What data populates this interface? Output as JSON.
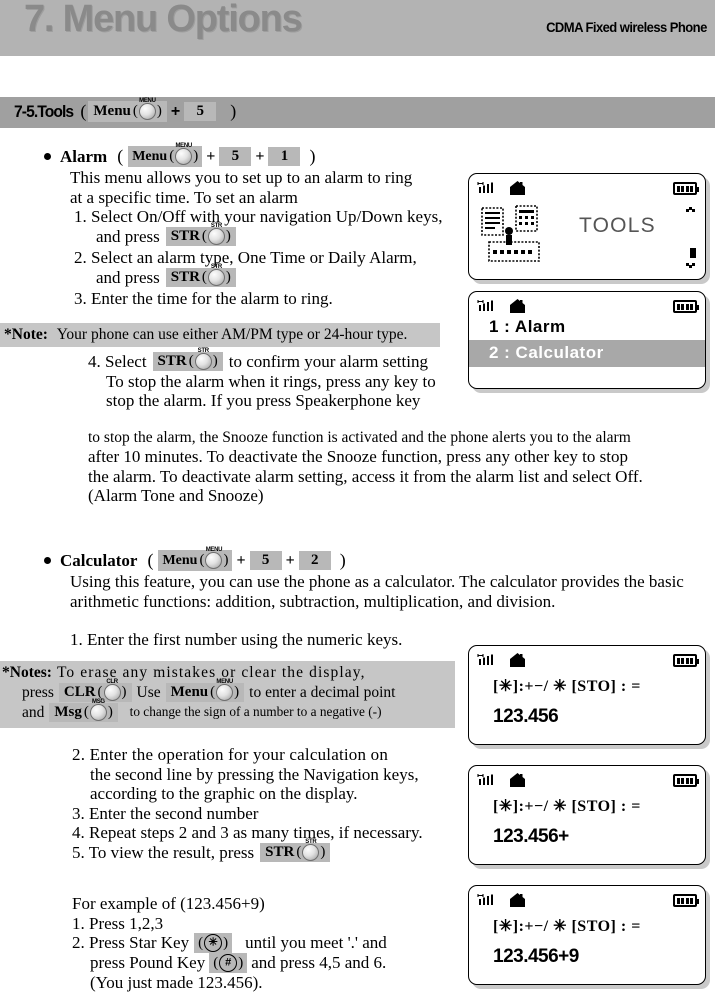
{
  "banner": {
    "title": "7. Menu Options",
    "subtitle": "CDMA Fixed wireless Phone"
  },
  "section": {
    "title": "7-5.Tools",
    "open_paren": "(",
    "menu_chip": {
      "label": "Menu",
      "key": "MENU"
    },
    "plus1": "+",
    "num1": "5",
    "close_paren": ")"
  },
  "alarm": {
    "heading": "Alarm",
    "open_paren": "(",
    "menu_chip": {
      "label": "Menu",
      "key": "MENU"
    },
    "plus1": "+",
    "num1": "5",
    "plus2": "+",
    "num2": "1",
    "close_paren": ")",
    "intro_line1": "This menu allows you to set up to an alarm to ring",
    "intro_line2": "at a specific time. To set an alarm",
    "step1_a": "1. Select On/Off with your navigation Up/Down keys,",
    "step1_b": "and press",
    "step1_chip": {
      "label": "STR",
      "key": "STR"
    },
    "step2_a": "2. Select an alarm type, One Time or Daily Alarm,",
    "step2_b": "and press",
    "step2_chip": {
      "label": "STR",
      "key": "STR"
    },
    "step3": "3. Enter the time for the alarm to ring.",
    "note_label": "*Note:",
    "note_text": "Your phone can use either AM/PM type or 24-hour type.",
    "step4_a": "4. Select",
    "step4_chip": {
      "label": "STR",
      "key": "STR"
    },
    "step4_b": "to confirm your alarm setting",
    "step4_line2": "To stop the alarm when it rings, press any key to",
    "step4_line3": "stop the alarm. If you press Speakerphone key",
    "wide_line1": "to stop the alarm, the Snooze function is activated and the phone alerts you to the alarm",
    "wide_line2": "after 10 minutes. To deactivate the Snooze function, press any other key to stop",
    "wide_line3": "the alarm. To deactivate alarm setting, access it from the alarm list and select Off.",
    "wide_line4": "(Alarm Tone and Snooze)"
  },
  "calculator": {
    "heading": "Calculator",
    "open_paren": "(",
    "menu_chip": {
      "label": "Menu",
      "key": "MENU"
    },
    "plus1": "+",
    "num1": "5",
    "plus2": "+",
    "num2": "2",
    "close_paren": ")",
    "intro_line1": "Using this feature, you can use the phone as a calculator. The calculator provides the basic",
    "intro_line2": "arithmetic functions: addition, subtraction, multiplication, and division.",
    "step1": "1. Enter the first number using the numeric keys.",
    "notes_label": "*Notes:",
    "notes_line1": "To erase any mistakes or clear the display,",
    "notes_line2_a": "press",
    "notes_clr_chip": {
      "label": "CLR",
      "key": "CLR"
    },
    "notes_line2_b": "Use",
    "notes_menu_chip": {
      "label": "Menu",
      "key": "MENU"
    },
    "notes_line2_c": "to enter a decimal point",
    "notes_line3_a": "and",
    "notes_msg_chip": {
      "label": "Msg",
      "key": "MSG"
    },
    "notes_line3_b": "to change the sign of a number to a negative (-)",
    "step2_a": "2. Enter the operation for your calculation on",
    "step2_b": "the second line by pressing the Navigation keys,",
    "step2_c": "according to the graphic on the display.",
    "step3": "3. Enter the second number",
    "step4": "4. Repeat steps 2 and 3 as many times, if necessary.",
    "step5_a": "5. To view the result, press",
    "step5_chip": {
      "label": "STR",
      "key": "STR"
    },
    "example_title": "For example of (123.456+9)",
    "ex1": "1. Press 1,2,3",
    "ex2_a": "2. Press Star Key",
    "ex2_star_chip": "✳",
    "ex2_b": "until you meet '.' and",
    "ex2_c": "press Pound Key",
    "ex2_pound_chip": "#",
    "ex2_d": "and press 4,5 and 6.",
    "ex2_e": "(You just made 123.456)."
  },
  "screens": {
    "tools": {
      "title": "TOOLS",
      "battery_bars": 4
    },
    "menu_list": {
      "item1": "1 : Alarm",
      "item2": "2 : Calculator"
    },
    "calc1": {
      "op_line": "[✳]:+−/ ✳  [STO] : =",
      "op_prefix": "[",
      "value": "123.456"
    },
    "calc2": {
      "op_line": "[✳]:+−/ ✳  [STO] : =",
      "value": "123.456+"
    },
    "calc3": {
      "op_line": "[✳]:+−/ ✳  [STO] : =",
      "value": "123.456+9"
    }
  },
  "colors": {
    "banner_bg": "#b3b3b3",
    "section_bg": "#a0a0a0",
    "chip_bg": "#b8b8b8",
    "note_bg": "#c6c6c6",
    "highlight_bg": "#a8a8a8"
  }
}
